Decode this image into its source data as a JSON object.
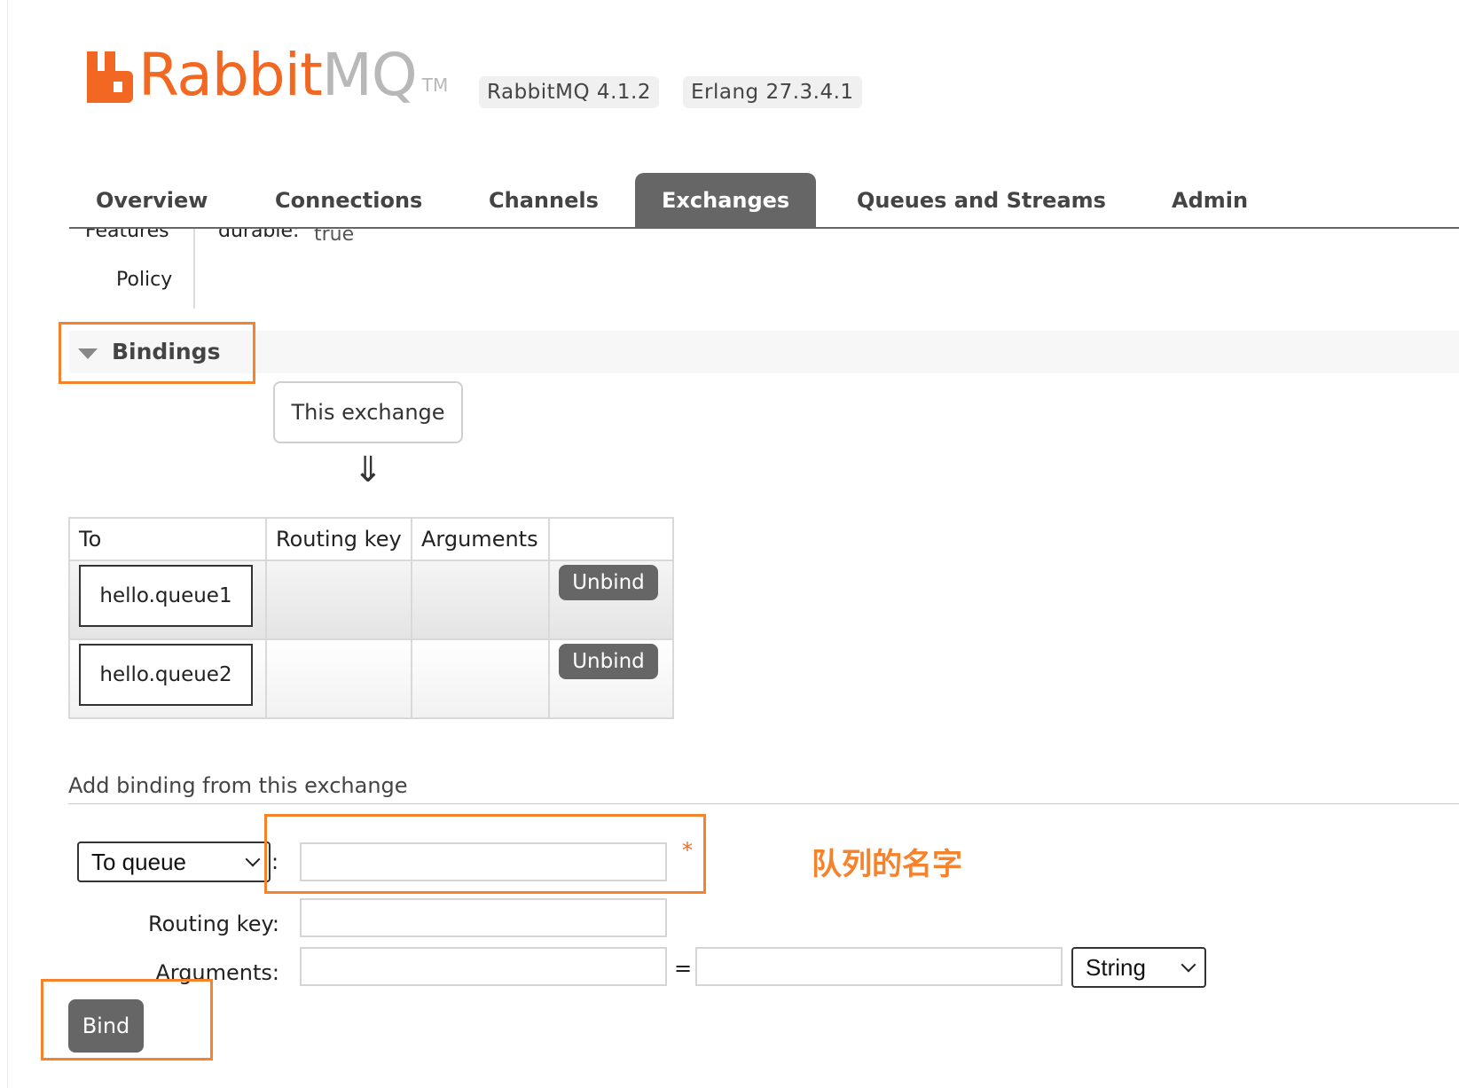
{
  "header": {
    "logo_rabbit": "Rabbit",
    "logo_mq": "MQ",
    "logo_tm": "TM",
    "rabbitmq_version": "RabbitMQ 4.1.2",
    "erlang_version": "Erlang 27.3.4.1"
  },
  "nav": {
    "tabs": [
      {
        "label": "Overview"
      },
      {
        "label": "Connections"
      },
      {
        "label": "Channels"
      },
      {
        "label": "Exchanges",
        "active": true
      },
      {
        "label": "Queues and Streams"
      },
      {
        "label": "Admin"
      }
    ]
  },
  "details": {
    "features_label": "Features",
    "features_value_key": "durable:",
    "features_value": "true",
    "policy_label": "Policy"
  },
  "bindings": {
    "title": "Bindings",
    "this_exchange": "This exchange",
    "arrow": "⇓",
    "columns": [
      "To",
      "Routing key",
      "Arguments",
      ""
    ],
    "rows": [
      {
        "to": "hello.queue1",
        "routing_key": "",
        "arguments": "",
        "action": "Unbind"
      },
      {
        "to": "hello.queue2",
        "routing_key": "",
        "arguments": "",
        "action": "Unbind"
      }
    ]
  },
  "add_binding": {
    "title": "Add binding from this exchange",
    "destination_type": "To queue",
    "colon": ":",
    "required_mark": "*",
    "routing_key_label": "Routing key:",
    "arguments_label": "Arguments:",
    "equals": "=",
    "argument_type": "String",
    "bind_button": "Bind"
  },
  "annotation": {
    "queue_name_note": "队列的名字",
    "color": "#f6822b"
  },
  "colors": {
    "brand_orange": "#f26822",
    "tab_active_bg": "#666666",
    "button_bg": "#666666"
  }
}
